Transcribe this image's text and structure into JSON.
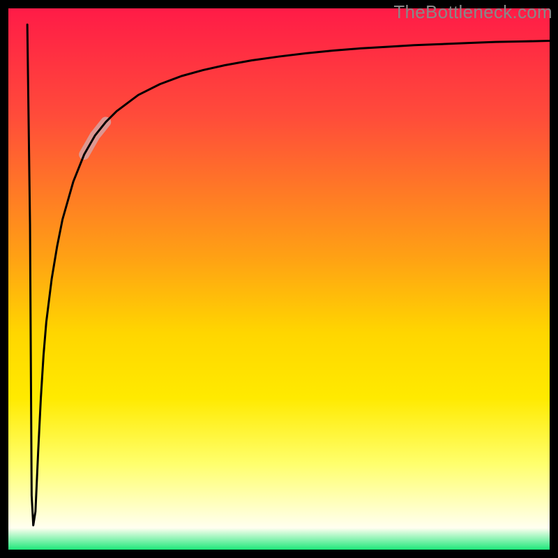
{
  "watermark": "TheBottleneck.com",
  "chart_data": {
    "type": "line",
    "title": "",
    "xlabel": "",
    "ylabel": "",
    "xlim": [
      0,
      100
    ],
    "ylim": [
      0,
      100
    ],
    "grid": false,
    "series": [
      {
        "name": "curve",
        "x": [
          3.5,
          4.0,
          4.3,
          4.6,
          5.0,
          5.5,
          6.0,
          6.5,
          7.0,
          8.0,
          9.0,
          10.0,
          12.0,
          14.0,
          16.0,
          18.0,
          20.0,
          24.0,
          28.0,
          32.0,
          36.0,
          40.0,
          45.0,
          50.0,
          55.0,
          60.0,
          65.0,
          70.0,
          75.0,
          80.0,
          85.0,
          90.0,
          95.0,
          100.0
        ],
        "y": [
          97.0,
          60.0,
          10.0,
          4.5,
          7.0,
          18.0,
          28.0,
          36.0,
          42.0,
          50.0,
          56.0,
          61.0,
          68.0,
          73.0,
          76.5,
          79.0,
          81.0,
          84.0,
          86.0,
          87.5,
          88.6,
          89.5,
          90.4,
          91.1,
          91.7,
          92.2,
          92.6,
          92.9,
          93.2,
          93.4,
          93.6,
          93.8,
          93.9,
          94.0
        ]
      }
    ],
    "highlight_segment": {
      "x0": 14.0,
      "x1": 18.0,
      "y0": 73.0,
      "y1": 79.0
    },
    "background_gradient_stops": [
      {
        "pos": 0.0,
        "color": "#ff1b47"
      },
      {
        "pos": 0.2,
        "color": "#ff4c3a"
      },
      {
        "pos": 0.46,
        "color": "#ffa114"
      },
      {
        "pos": 0.6,
        "color": "#ffd600"
      },
      {
        "pos": 0.72,
        "color": "#ffea00"
      },
      {
        "pos": 0.84,
        "color": "#ffff6b"
      },
      {
        "pos": 0.96,
        "color": "#fffff0"
      },
      {
        "pos": 1.0,
        "color": "#1ee87a"
      }
    ],
    "frame_thickness_px": 12,
    "curve_stroke_px": 3,
    "highlight_stroke_px": 15,
    "highlight_color": "#d7a2a2"
  }
}
